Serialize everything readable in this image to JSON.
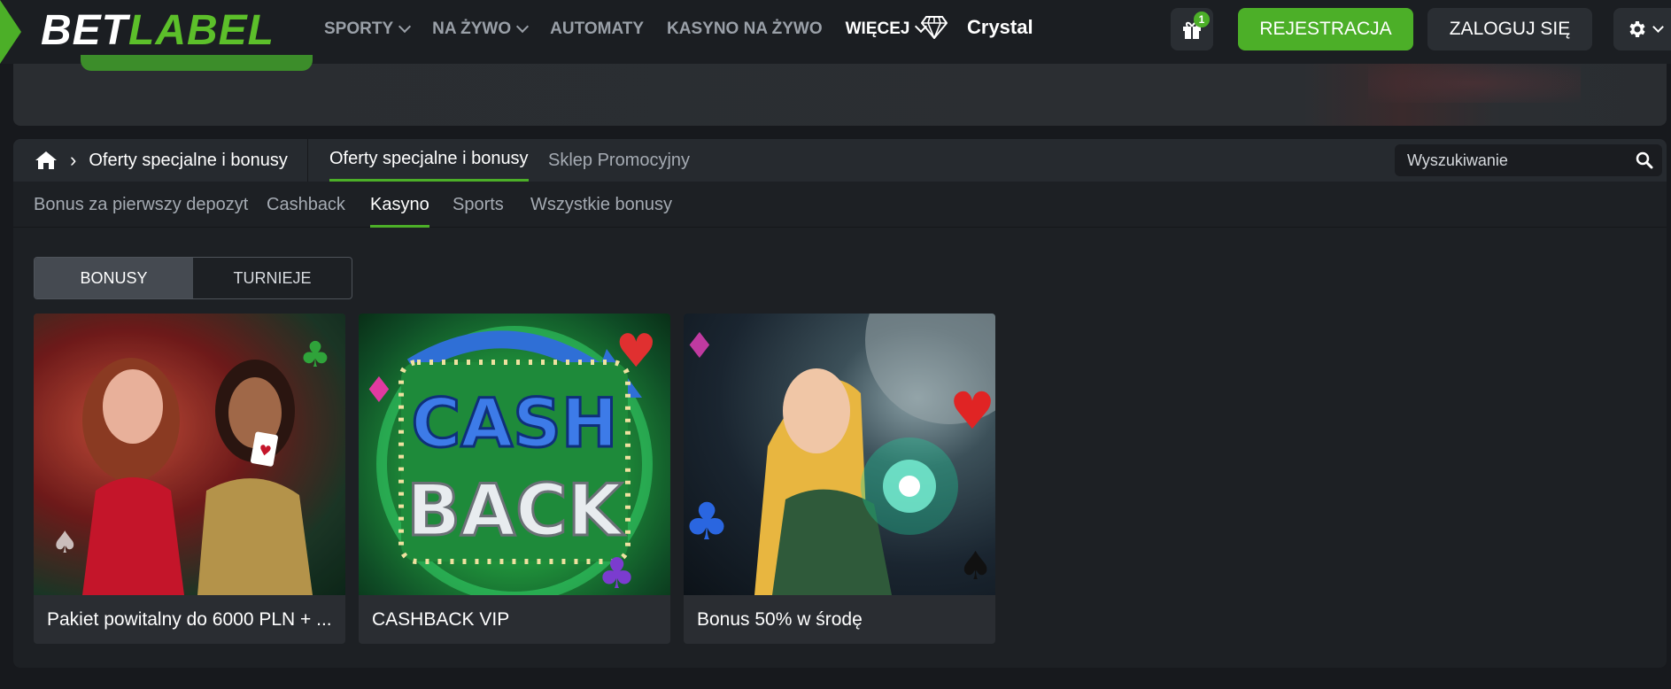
{
  "header": {
    "logo_bet": "BET",
    "logo_label": "LABEL",
    "nav": [
      {
        "label": "SPORTY",
        "dropdown": true
      },
      {
        "label": "NA ŻYWO",
        "dropdown": true
      },
      {
        "label": "AUTOMATY",
        "dropdown": false
      },
      {
        "label": "KASYNO NA ŻYWO",
        "dropdown": false
      },
      {
        "label": "WIĘCEJ",
        "dropdown": true
      }
    ],
    "crystal_label": "Crystal",
    "gift_badge": "1",
    "register_label": "REJESTRACJA",
    "login_label": "ZALOGUJ SIĘ"
  },
  "subnav": {
    "breadcrumb": "Oferty specjalne i bonusy",
    "tabs": [
      "Oferty specjalne i bonusy",
      "Sklep Promocyjny"
    ],
    "search_placeholder": "Wyszukiwanie"
  },
  "categories": [
    "Bonus za pierwszy depozyt",
    "Cashback",
    "Kasyno",
    "Sports",
    "Wszystkie bonusy"
  ],
  "active_category": "Kasyno",
  "toggle": {
    "bonuses": "BONUSY",
    "tournaments": "TURNIEJE"
  },
  "cards": [
    {
      "title": "Pakiet powitalny do 6000 PLN + ..."
    },
    {
      "title": "CASHBACK VIP",
      "art_text_1": "CASH",
      "art_text_2": "BACK"
    },
    {
      "title": "Bonus 50% w środę"
    }
  ],
  "colors": {
    "accent": "#4caf28",
    "bg": "#17191d",
    "panel": "#1d2024"
  }
}
